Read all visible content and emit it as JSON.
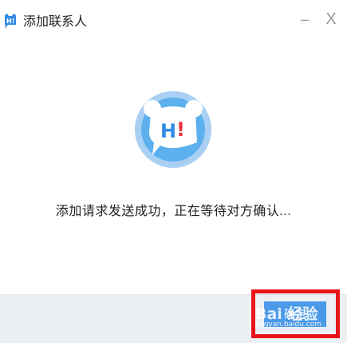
{
  "window": {
    "title": "添加联系人",
    "minimize_glyph": "–",
    "close_glyph": "X"
  },
  "logo": {
    "text": "H!",
    "icon": "bear-chat-logo-icon",
    "colors": {
      "outer": "#a9cff3",
      "inner": "#5cb0ee",
      "bubble": "#ffffff",
      "h": "#2f8be6",
      "bang": "#e8313a"
    }
  },
  "message": "添加请求发送成功，正在等待对方确认...",
  "footer": {
    "confirm_label": "确定"
  },
  "overlay": {
    "highlight_color": "#e8141b",
    "watermark_main": "Bai 经验",
    "watermark_sub": "jingyan.baidu.com"
  }
}
